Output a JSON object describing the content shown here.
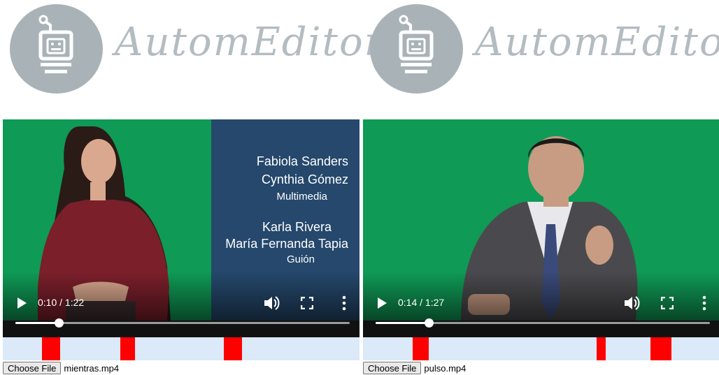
{
  "brand": {
    "name": "AutomEditor",
    "logo_color": "#a9b3b7"
  },
  "players": [
    {
      "time": "0:10 / 1:22",
      "progress": 0.13,
      "credits": {
        "name1": "Fabiola Sanders",
        "name2": "Cynthia Gómez",
        "role1": "Multimedia",
        "name3": "Karla Rivera",
        "name4": "María Fernanda Tapia",
        "role2": "Guión"
      },
      "markers": [
        {
          "start": 0.11,
          "end": 0.16
        },
        {
          "start": 0.33,
          "end": 0.37
        },
        {
          "start": 0.62,
          "end": 0.67
        }
      ],
      "file": {
        "button": "Choose File",
        "name": "mientras.mp4"
      }
    },
    {
      "time": "0:14 / 1:27",
      "progress": 0.16,
      "markers": [
        {
          "start": 0.14,
          "end": 0.185
        },
        {
          "start": 0.655,
          "end": 0.68
        },
        {
          "start": 0.805,
          "end": 0.865
        }
      ],
      "file": {
        "button": "Choose File",
        "name": "pulso.mp4"
      }
    }
  ],
  "colors": {
    "green_screen": "#0f9a55",
    "marker": "#ff0000",
    "timeline_bg": "#dbe9f8",
    "credits_bg": "#25486c"
  },
  "icons": {
    "play": "play-icon",
    "volume": "volume-icon",
    "fullscreen": "fullscreen-icon",
    "more": "more-vert-icon"
  }
}
